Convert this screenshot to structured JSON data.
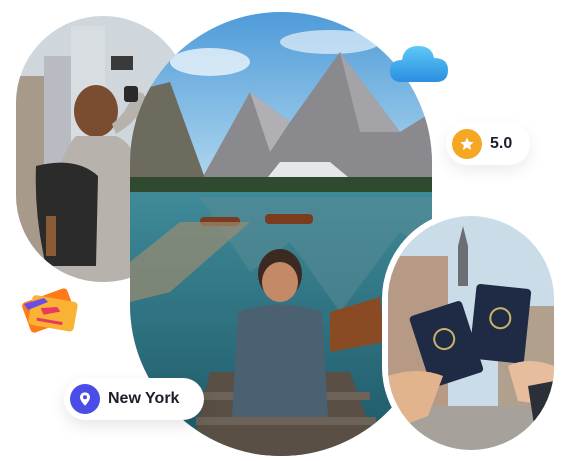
{
  "rating": {
    "value": "5.0",
    "icon": "star-icon",
    "badge_color": "#f5a623"
  },
  "location": {
    "name": "New York",
    "icon": "map-pin-icon",
    "badge_color": "#4a4de6"
  },
  "decorations": {
    "cloud_icon": "cloud-icon",
    "tickets_icon": "flight-tickets-icon"
  },
  "images": {
    "left": "city-photographer-photo",
    "center": "mountain-lake-photo",
    "right": "passports-photo"
  }
}
